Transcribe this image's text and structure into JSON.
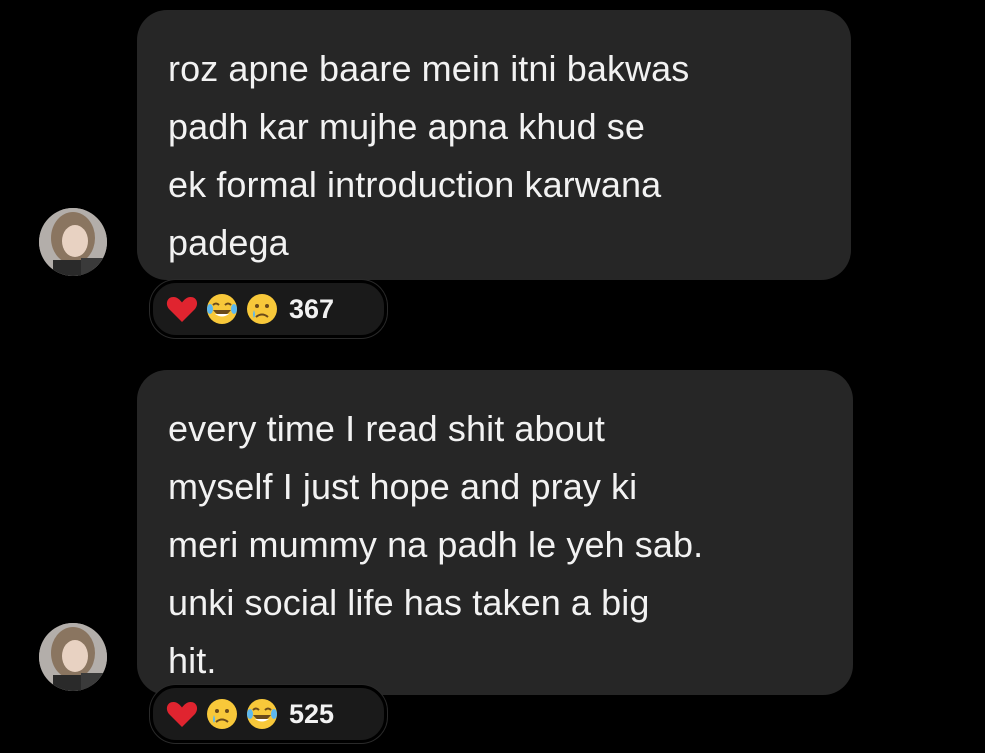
{
  "messages": [
    {
      "text": "roz apne baare mein itni bakwas\npadh kar mujhe apna khud se\nek formal introduction karwana\npadega",
      "reactions": [
        "heart",
        "laughing-crying",
        "crying"
      ],
      "reaction_count": "367"
    },
    {
      "text": "every time I read shit about\nmyself I just hope and pray ki\nmeri mummy na padh le yeh sab.\nunki social life has taken a big\nhit.",
      "reactions": [
        "heart",
        "crying",
        "laughing-crying"
      ],
      "reaction_count": "525"
    }
  ],
  "colors": {
    "background": "#000000",
    "bubble": "#262626",
    "text": "#f2f2f2",
    "heart": "#e0242f",
    "emoji": "#f8c83a"
  }
}
